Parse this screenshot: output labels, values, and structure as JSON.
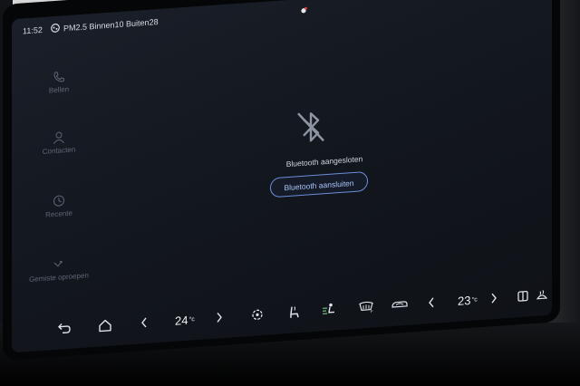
{
  "status_bar": {
    "time": "11:52",
    "air_quality": "PM2.5 Binnen10 Buiten28",
    "system_icons": [
      "notification-dot-icon",
      "bluetooth-icon",
      "signal-icon",
      "wifi-icon",
      "gps-icon"
    ]
  },
  "sidebar": {
    "items": [
      {
        "label": "Bellen",
        "icon": "phone-icon"
      },
      {
        "label": "Contacten",
        "icon": "contacts-icon"
      },
      {
        "label": "Recente",
        "icon": "clock-icon"
      },
      {
        "label": "Gemiste oproepen",
        "icon": "missed-call-icon"
      }
    ]
  },
  "main": {
    "bluetooth_status": "Bluetooth aangesloten",
    "connect_button": "Bluetooth aansluiten"
  },
  "dock": {
    "left_temp": "24",
    "right_temp": "23",
    "temp_unit": "°c",
    "icons": [
      "back-icon",
      "home-icon",
      "left-temp-decrease",
      "left-temp-increase",
      "fan-icon",
      "seat-heat-icon",
      "airflow-icon",
      "rear-defrost-icon",
      "recirculation-icon",
      "right-temp-decrease",
      "right-temp-increase",
      "split-screen-icon",
      "steering-heat-icon"
    ]
  },
  "colors": {
    "accent": "#6c8ed8",
    "background": "#141922"
  }
}
